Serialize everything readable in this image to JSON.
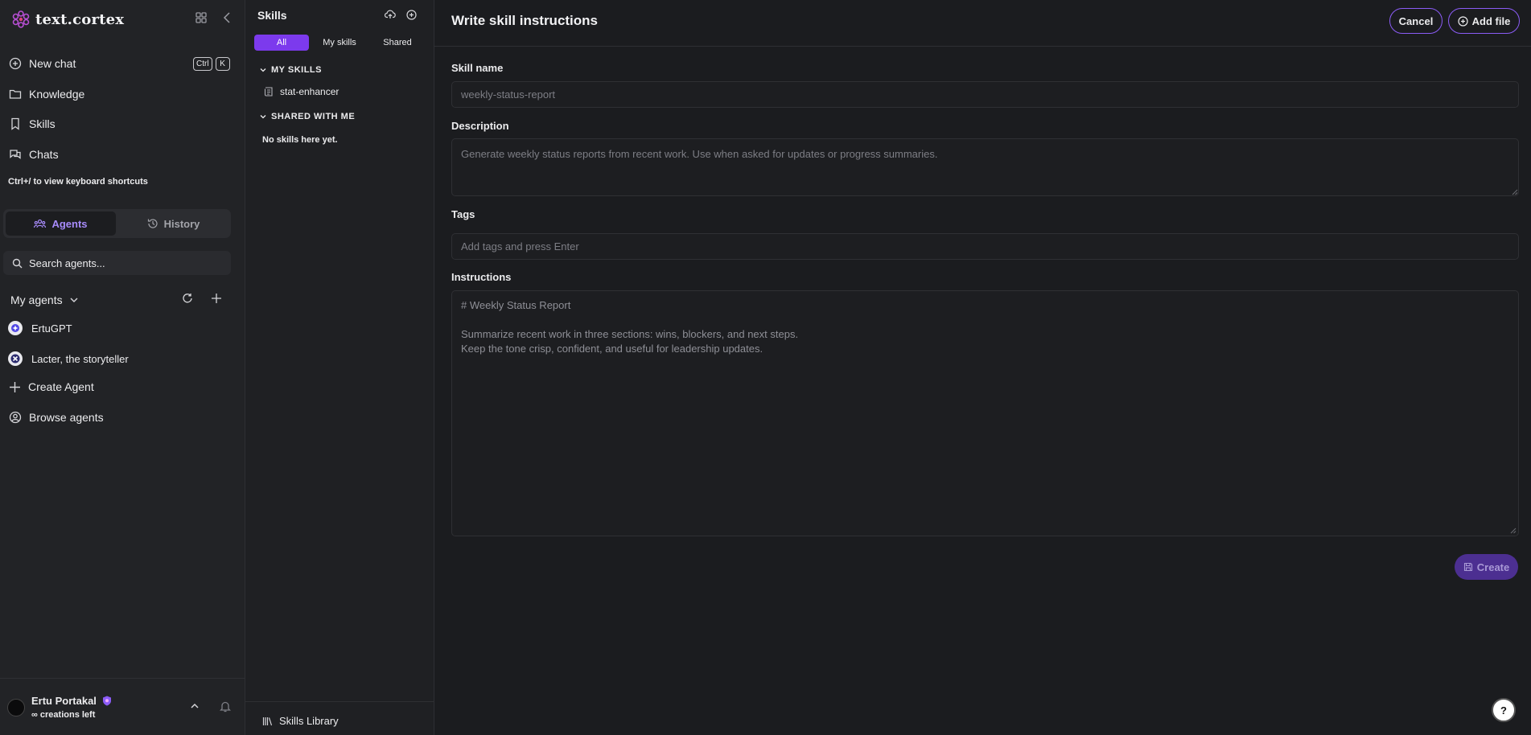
{
  "app": {
    "logo_text": "text.cortex",
    "accent": "#7c3aed"
  },
  "sidebar": {
    "new_chat": "New chat",
    "shortcut_keys": [
      "Ctrl",
      "K"
    ],
    "nav": [
      "Knowledge",
      "Skills",
      "Chats"
    ],
    "shortcuts_hint": "Ctrl+/ to view keyboard shortcuts",
    "segment": {
      "agents": "Agents",
      "history": "History",
      "active": "agents"
    },
    "search_placeholder": "Search agents...",
    "my_agents_label": "My agents",
    "agents": [
      "ErtuGPT",
      "Lacter, the storyteller"
    ],
    "create_agent": "Create Agent",
    "browse_agents": "Browse agents",
    "profile": {
      "name": "Ertu Portakal",
      "subtitle": "∞ creations left"
    }
  },
  "skills_panel": {
    "title": "Skills",
    "tabs": [
      "All",
      "My skills",
      "Shared"
    ],
    "active_tab": "All",
    "sections": {
      "my_skills": "MY SKILLS",
      "shared": "SHARED WITH ME"
    },
    "my_skills_items": [
      "stat-enhancer"
    ],
    "shared_empty": "No skills here yet.",
    "library_label": "Skills Library"
  },
  "main": {
    "title": "Write skill instructions",
    "cancel_label": "Cancel",
    "add_file_label": "Add file",
    "skill_name_label": "Skill name",
    "skill_name_placeholder": "weekly-status-report",
    "description_label": "Description",
    "description_placeholder": "Generate weekly status reports from recent work. Use when asked for updates or progress summaries.",
    "tags_label": "Tags",
    "tags_placeholder": "Add tags and press Enter",
    "instructions_label": "Instructions",
    "instructions_lines": [
      "# Weekly Status Report",
      "",
      "Summarize recent work in three sections: wins, blockers, and next steps.",
      "Keep the tone crisp, confident, and useful for leadership updates."
    ],
    "create_label": "Create",
    "help_label": "?"
  }
}
